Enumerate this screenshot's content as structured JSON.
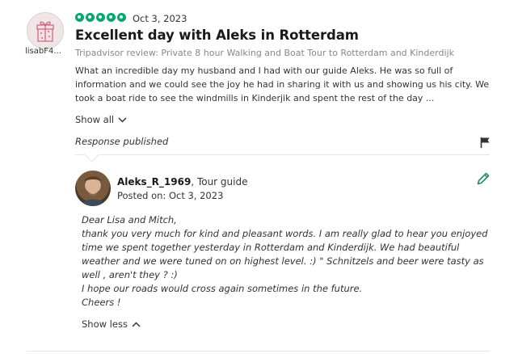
{
  "review": {
    "username": "lisabF4...",
    "rating_value": 5,
    "rating_max": 5,
    "date": "Oct 3, 2023",
    "title": "Excellent day with Aleks in Rotterdam",
    "subtitle": "Tripadvisor review: Private 8 hour Walking and Boat Tour to Rotterdam and Kinderdijk",
    "body": "What an incredible day my husband and I had with our guide Aleks. He was so full of information and we could see the joy he had in sharing it with us and showing us his city. We took a boat ride to see the windmills in Kinderjik and spent the rest of the day ...",
    "show_all_label": "Show all",
    "response_label": "Response published"
  },
  "response": {
    "guide_name": "Aleks_R_1969",
    "guide_role": ", Tour guide",
    "posted_on": "Posted on: Oct 3, 2023",
    "lines": [
      "Dear Lisa and Mitch,",
      "thank you very much for kind and pleasant words. I am really glad to hear you enjoyed time we spent together yesterday in Rotterdam and Kinderdijk. We had beautiful weather and we were tuned on on highest level. :) \" Schnitzels and beer were tasty as well , aren't they ? :)",
      "I hope our roads would cross again sometimes in the future.",
      "Cheers !"
    ],
    "show_less_label": "Show less"
  },
  "icons": {
    "avatar": "gift-avatar-icon",
    "rating": "rating-bubble-icon",
    "show_all": "chevron-down-icon",
    "flag": "flag-icon",
    "edit": "pencil-icon",
    "show_less": "chevron-up-icon"
  },
  "colors": {
    "rating": "#00aa6c",
    "edit_icon": "#2a8a6a",
    "avatar_gift": "#d06a82"
  }
}
